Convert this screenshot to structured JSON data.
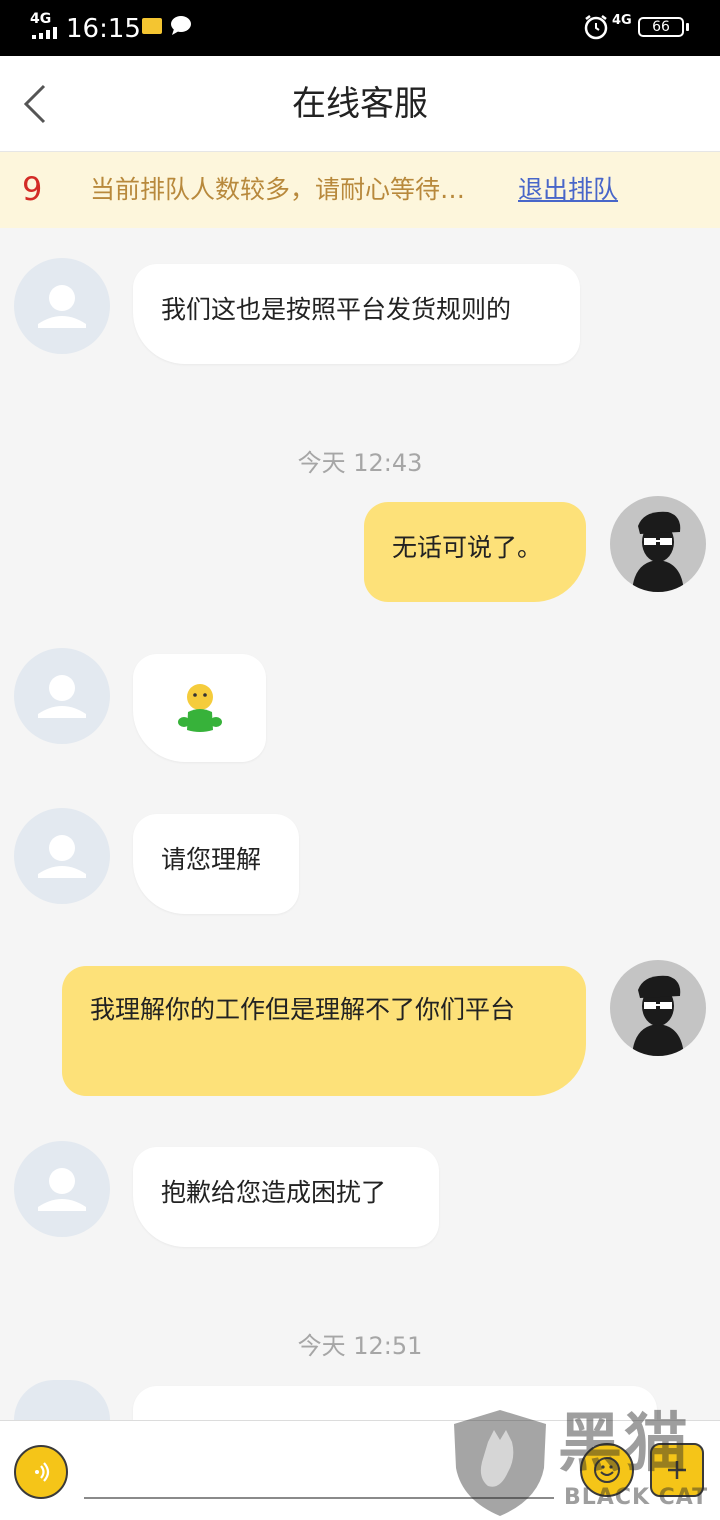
{
  "status_bar": {
    "signal_left": "4G",
    "time": "16:15",
    "signal_right": "4G",
    "battery": "66",
    "icons": [
      "signal-icon",
      "mail-icon",
      "chat-icon",
      "alarm-icon",
      "battery-icon"
    ]
  },
  "header": {
    "title": "在线客服",
    "back_icon": "chevron-left-icon"
  },
  "queue": {
    "position": "9",
    "message": "当前排队人数较多，请耐心等待…",
    "exit_label": "退出排队"
  },
  "messages": [
    {
      "from": "agent",
      "text": "我们这也是按照平台发货规则的"
    },
    {
      "type": "timestamp",
      "text": "今天 12:43"
    },
    {
      "from": "user",
      "text": "无话可说了。"
    },
    {
      "from": "agent",
      "content": "emoji-icon"
    },
    {
      "from": "agent",
      "text": "请您理解"
    },
    {
      "from": "user",
      "text": "我理解你的工作但是理解不了你们平台"
    },
    {
      "from": "agent",
      "text": "抱歉给您造成困扰了"
    },
    {
      "type": "timestamp",
      "text": "今天 12:51"
    }
  ],
  "input_bar": {
    "voice_icon": "voice-icon",
    "emoji_icon": "emoji-icon",
    "plus_icon": "plus-icon"
  },
  "watermark": {
    "chinese": "黑猫",
    "english": "BLACK CAT"
  },
  "colors": {
    "queue_bg": "#fdf6dc",
    "queue_number": "#d32b26",
    "queue_text": "#b8893c",
    "exit_link": "#4866c9",
    "user_bubble": "#fde179",
    "agent_bubble": "#ffffff",
    "accent": "#f5c518"
  }
}
